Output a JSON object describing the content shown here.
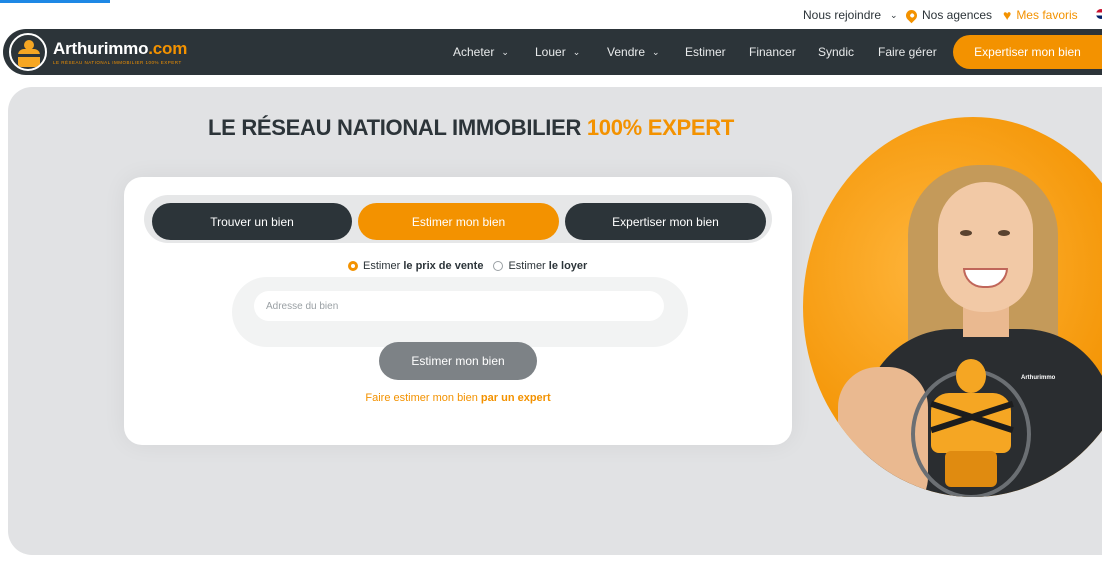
{
  "topbar": {
    "join": "Nous rejoindre",
    "agencies": "Nos agences",
    "favorites": "Mes favoris"
  },
  "brand": {
    "name_main": "Arthurimmo",
    "name_tld": ".com",
    "tagline": "LE RÉSEAU NATIONAL IMMOBILIER 100% EXPERT"
  },
  "nav": {
    "items": [
      {
        "label": "Acheter",
        "has_menu": true
      },
      {
        "label": "Louer",
        "has_menu": true
      },
      {
        "label": "Vendre",
        "has_menu": true
      },
      {
        "label": "Estimer",
        "has_menu": false
      },
      {
        "label": "Financer",
        "has_menu": false
      },
      {
        "label": "Syndic",
        "has_menu": false
      },
      {
        "label": "Faire gérer",
        "has_menu": false
      }
    ],
    "cta": "Expertiser mon bien"
  },
  "hero": {
    "title_main": "LE RÉSEAU NATIONAL IMMOBILIER ",
    "title_accent": "100% EXPERT"
  },
  "search": {
    "tabs": [
      {
        "label": "Trouver un bien",
        "active": false
      },
      {
        "label": "Estimer mon bien",
        "active": true
      },
      {
        "label": "Expertiser mon bien",
        "active": false
      }
    ],
    "radio_sale_prefix": "Estimer ",
    "radio_sale_bold": "le prix de vente",
    "radio_rent_prefix": "Estimer ",
    "radio_rent_bold": "le loyer",
    "selected_radio": "sale",
    "address_placeholder": "Adresse du bien",
    "address_value": "",
    "submit_label": "Estimer mon bien",
    "expert_prefix": "Faire estimer mon bien ",
    "expert_bold": "par un expert"
  },
  "colors": {
    "accent": "#f39200",
    "dark": "#2c3439",
    "hero_bg": "#e1e2e4",
    "button_gray": "#7d8286"
  },
  "icons": {
    "chevron": "chevron-down-icon",
    "agencies": "location-pin-icon",
    "favorites": "heart-icon",
    "language": "uk-flag-icon"
  }
}
